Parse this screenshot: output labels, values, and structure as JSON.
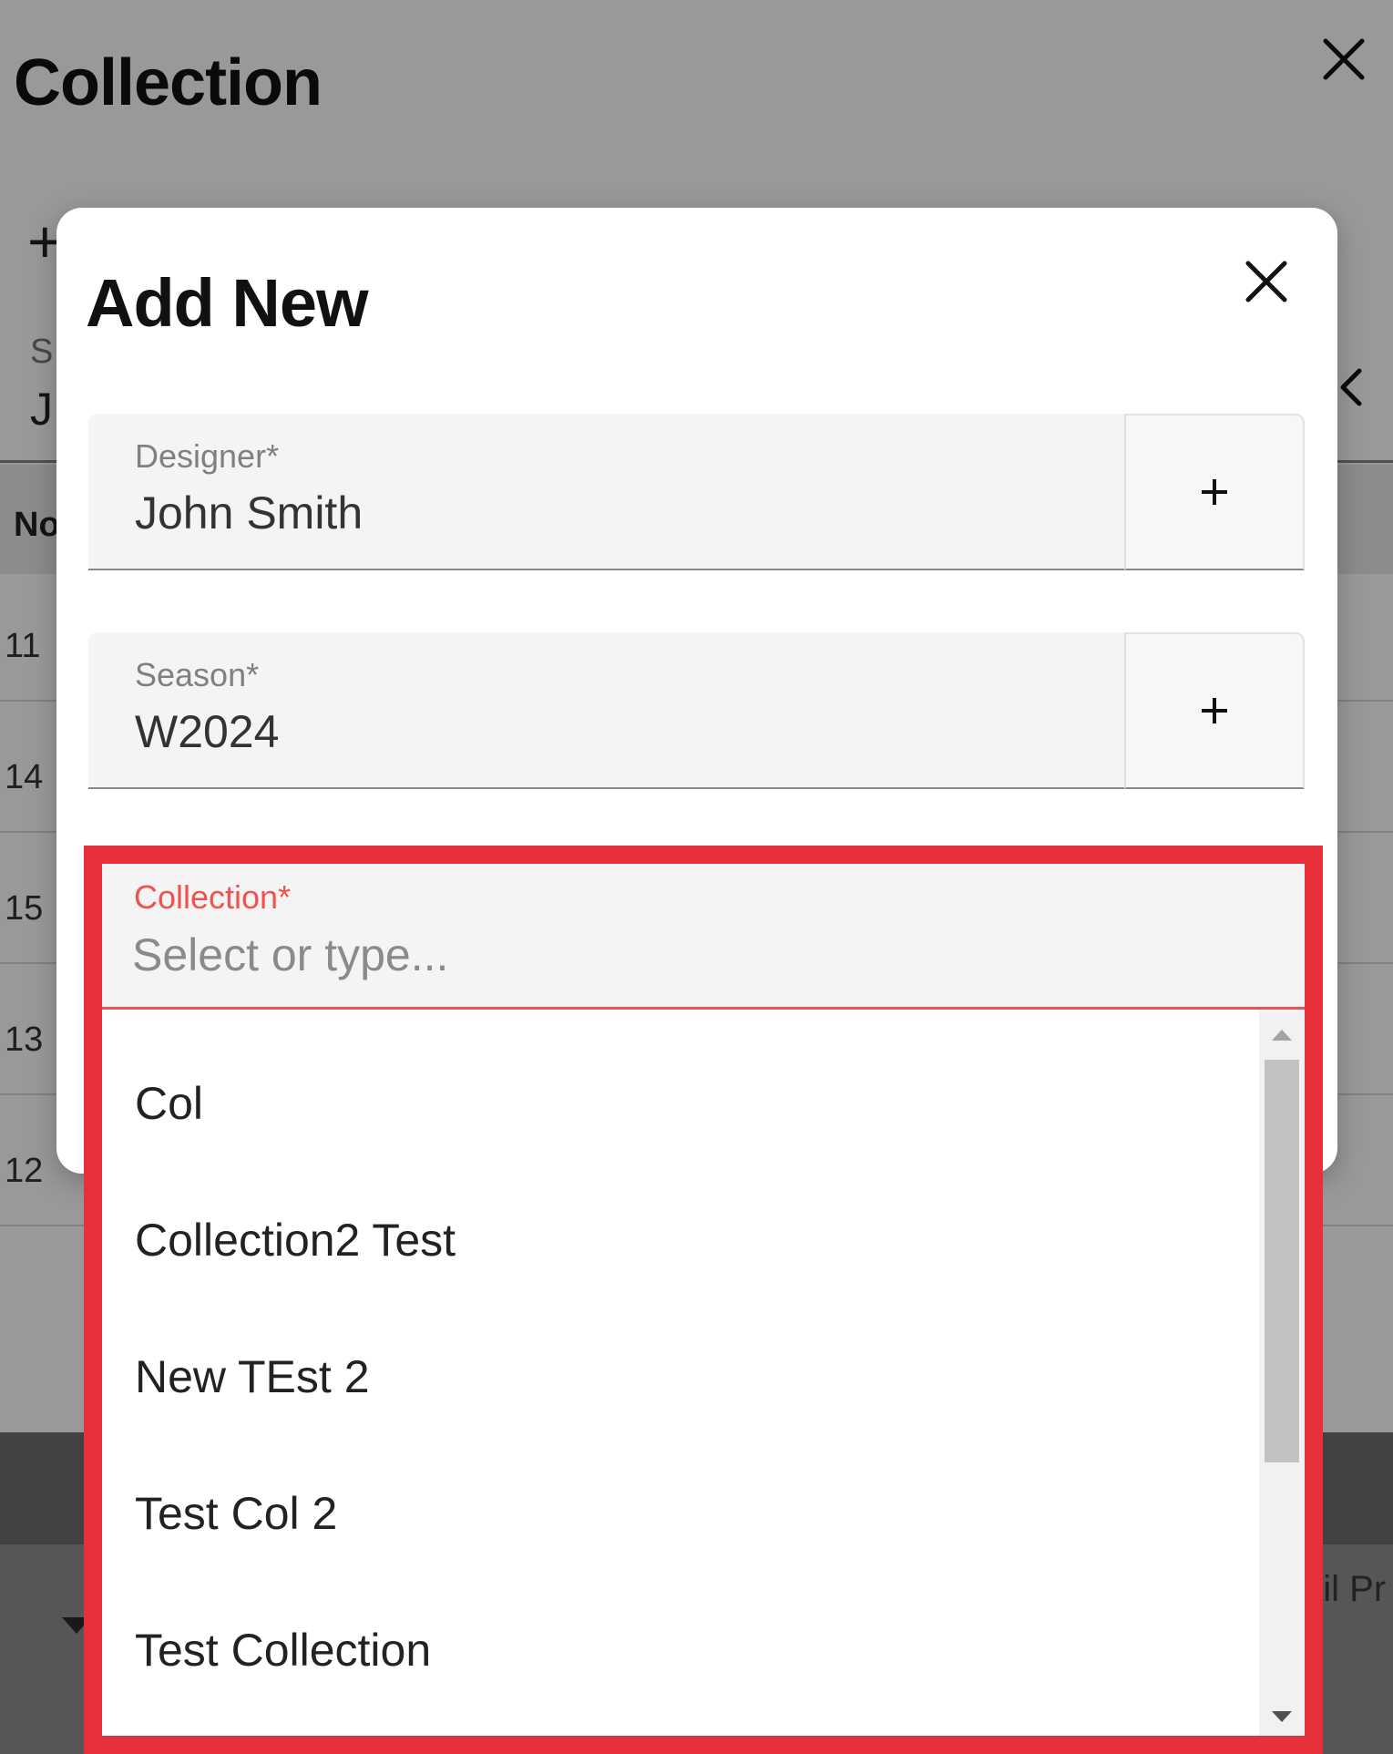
{
  "background_page": {
    "title": "Collection",
    "add_glyph": "+",
    "filter": {
      "label": "S",
      "value": "J"
    },
    "table": {
      "header": "No",
      "rows": [
        "11",
        "14",
        "15",
        "13",
        "12"
      ]
    },
    "footer_text": "ail Pr"
  },
  "dialog": {
    "title": "Add New",
    "fields": [
      {
        "label": "Designer*",
        "value": "John Smith",
        "add_label": "+"
      },
      {
        "label": "Season*",
        "value": "W2024",
        "add_label": "+"
      }
    ],
    "collection": {
      "label": "Collection*",
      "value": "",
      "placeholder": "Select or type...",
      "options": [
        "Col",
        "Collection2 Test",
        "New TEst 2",
        "Test Col 2",
        "Test Collection"
      ]
    }
  },
  "colors": {
    "highlight_border": "#e8303a",
    "error_accent": "#ef5350",
    "field_background": "#f4f4f4"
  },
  "icons": {
    "page_close": "close-icon",
    "dialog_close": "close-icon",
    "filter_chevron": "chevron-left-icon",
    "scroll_up": "arrow-up-icon",
    "scroll_down": "arrow-down-icon"
  }
}
